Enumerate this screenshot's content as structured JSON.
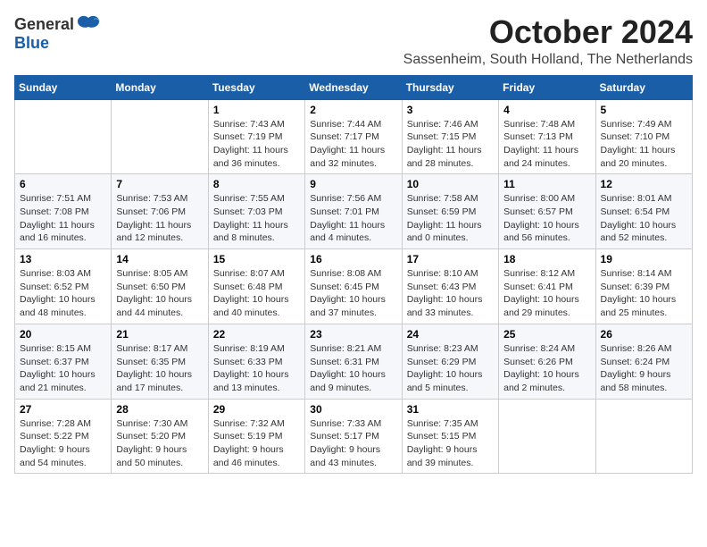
{
  "header": {
    "logo_general": "General",
    "logo_blue": "Blue",
    "month_title": "October 2024",
    "location": "Sassenheim, South Holland, The Netherlands"
  },
  "weekdays": [
    "Sunday",
    "Monday",
    "Tuesday",
    "Wednesday",
    "Thursday",
    "Friday",
    "Saturday"
  ],
  "weeks": [
    [
      {
        "day": "",
        "info": ""
      },
      {
        "day": "",
        "info": ""
      },
      {
        "day": "1",
        "info": "Sunrise: 7:43 AM\nSunset: 7:19 PM\nDaylight: 11 hours and 36 minutes."
      },
      {
        "day": "2",
        "info": "Sunrise: 7:44 AM\nSunset: 7:17 PM\nDaylight: 11 hours and 32 minutes."
      },
      {
        "day": "3",
        "info": "Sunrise: 7:46 AM\nSunset: 7:15 PM\nDaylight: 11 hours and 28 minutes."
      },
      {
        "day": "4",
        "info": "Sunrise: 7:48 AM\nSunset: 7:13 PM\nDaylight: 11 hours and 24 minutes."
      },
      {
        "day": "5",
        "info": "Sunrise: 7:49 AM\nSunset: 7:10 PM\nDaylight: 11 hours and 20 minutes."
      }
    ],
    [
      {
        "day": "6",
        "info": "Sunrise: 7:51 AM\nSunset: 7:08 PM\nDaylight: 11 hours and 16 minutes."
      },
      {
        "day": "7",
        "info": "Sunrise: 7:53 AM\nSunset: 7:06 PM\nDaylight: 11 hours and 12 minutes."
      },
      {
        "day": "8",
        "info": "Sunrise: 7:55 AM\nSunset: 7:03 PM\nDaylight: 11 hours and 8 minutes."
      },
      {
        "day": "9",
        "info": "Sunrise: 7:56 AM\nSunset: 7:01 PM\nDaylight: 11 hours and 4 minutes."
      },
      {
        "day": "10",
        "info": "Sunrise: 7:58 AM\nSunset: 6:59 PM\nDaylight: 11 hours and 0 minutes."
      },
      {
        "day": "11",
        "info": "Sunrise: 8:00 AM\nSunset: 6:57 PM\nDaylight: 10 hours and 56 minutes."
      },
      {
        "day": "12",
        "info": "Sunrise: 8:01 AM\nSunset: 6:54 PM\nDaylight: 10 hours and 52 minutes."
      }
    ],
    [
      {
        "day": "13",
        "info": "Sunrise: 8:03 AM\nSunset: 6:52 PM\nDaylight: 10 hours and 48 minutes."
      },
      {
        "day": "14",
        "info": "Sunrise: 8:05 AM\nSunset: 6:50 PM\nDaylight: 10 hours and 44 minutes."
      },
      {
        "day": "15",
        "info": "Sunrise: 8:07 AM\nSunset: 6:48 PM\nDaylight: 10 hours and 40 minutes."
      },
      {
        "day": "16",
        "info": "Sunrise: 8:08 AM\nSunset: 6:45 PM\nDaylight: 10 hours and 37 minutes."
      },
      {
        "day": "17",
        "info": "Sunrise: 8:10 AM\nSunset: 6:43 PM\nDaylight: 10 hours and 33 minutes."
      },
      {
        "day": "18",
        "info": "Sunrise: 8:12 AM\nSunset: 6:41 PM\nDaylight: 10 hours and 29 minutes."
      },
      {
        "day": "19",
        "info": "Sunrise: 8:14 AM\nSunset: 6:39 PM\nDaylight: 10 hours and 25 minutes."
      }
    ],
    [
      {
        "day": "20",
        "info": "Sunrise: 8:15 AM\nSunset: 6:37 PM\nDaylight: 10 hours and 21 minutes."
      },
      {
        "day": "21",
        "info": "Sunrise: 8:17 AM\nSunset: 6:35 PM\nDaylight: 10 hours and 17 minutes."
      },
      {
        "day": "22",
        "info": "Sunrise: 8:19 AM\nSunset: 6:33 PM\nDaylight: 10 hours and 13 minutes."
      },
      {
        "day": "23",
        "info": "Sunrise: 8:21 AM\nSunset: 6:31 PM\nDaylight: 10 hours and 9 minutes."
      },
      {
        "day": "24",
        "info": "Sunrise: 8:23 AM\nSunset: 6:29 PM\nDaylight: 10 hours and 5 minutes."
      },
      {
        "day": "25",
        "info": "Sunrise: 8:24 AM\nSunset: 6:26 PM\nDaylight: 10 hours and 2 minutes."
      },
      {
        "day": "26",
        "info": "Sunrise: 8:26 AM\nSunset: 6:24 PM\nDaylight: 9 hours and 58 minutes."
      }
    ],
    [
      {
        "day": "27",
        "info": "Sunrise: 7:28 AM\nSunset: 5:22 PM\nDaylight: 9 hours and 54 minutes."
      },
      {
        "day": "28",
        "info": "Sunrise: 7:30 AM\nSunset: 5:20 PM\nDaylight: 9 hours and 50 minutes."
      },
      {
        "day": "29",
        "info": "Sunrise: 7:32 AM\nSunset: 5:19 PM\nDaylight: 9 hours and 46 minutes."
      },
      {
        "day": "30",
        "info": "Sunrise: 7:33 AM\nSunset: 5:17 PM\nDaylight: 9 hours and 43 minutes."
      },
      {
        "day": "31",
        "info": "Sunrise: 7:35 AM\nSunset: 5:15 PM\nDaylight: 9 hours and 39 minutes."
      },
      {
        "day": "",
        "info": ""
      },
      {
        "day": "",
        "info": ""
      }
    ]
  ]
}
